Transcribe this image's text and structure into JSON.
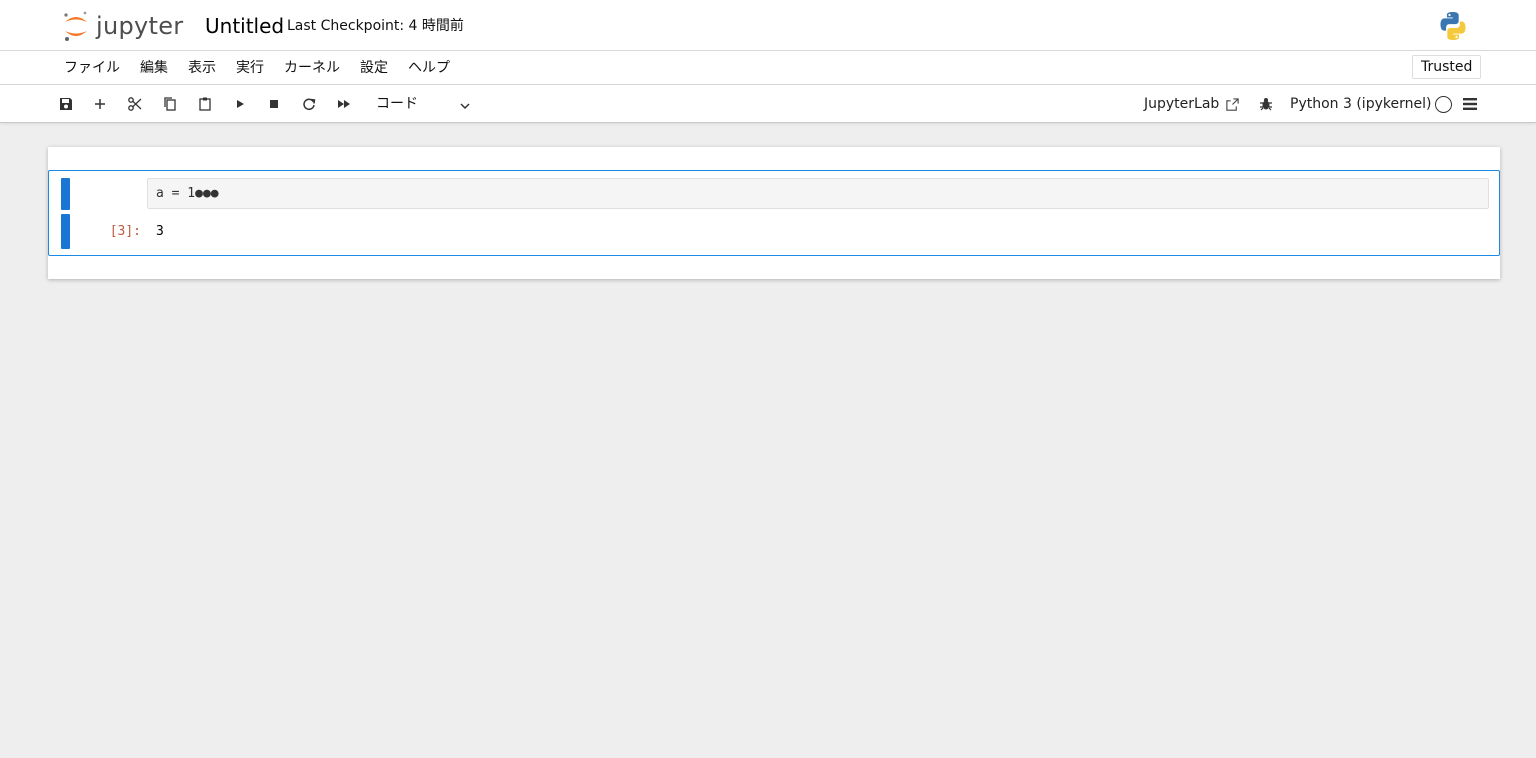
{
  "header": {
    "logo_text": "jupyter",
    "notebook_title": "Untitled",
    "checkpoint": "Last Checkpoint: 4 時間前",
    "logo_icon": "jupyter-logo-icon",
    "kernel_logo_icon": "python-logo-icon"
  },
  "menubar": {
    "items": [
      "ファイル",
      "編集",
      "表示",
      "実行",
      "カーネル",
      "設定",
      "ヘルプ"
    ],
    "trusted_label": "Trusted"
  },
  "toolbar": {
    "buttons": [
      "save-icon",
      "add-icon",
      "cut-icon",
      "copy-icon",
      "paste-icon",
      "run-icon",
      "stop-icon",
      "restart-icon",
      "fast-forward-icon"
    ],
    "cell_type": "コード",
    "jupyterlab_label": "JupyterLab",
    "kernel_name": "Python 3 (ipykernel)"
  },
  "cell": {
    "input_prompt": "",
    "source": "a = 1●●●",
    "output_prompt": "[3]:",
    "output": "3"
  },
  "colors": {
    "background": "#eeeeee",
    "active_cell_border": "#1e88e5",
    "collapser": "#1976d2",
    "jupyter_orange": "#f37726",
    "output_prompt": "#bf5b3d"
  }
}
